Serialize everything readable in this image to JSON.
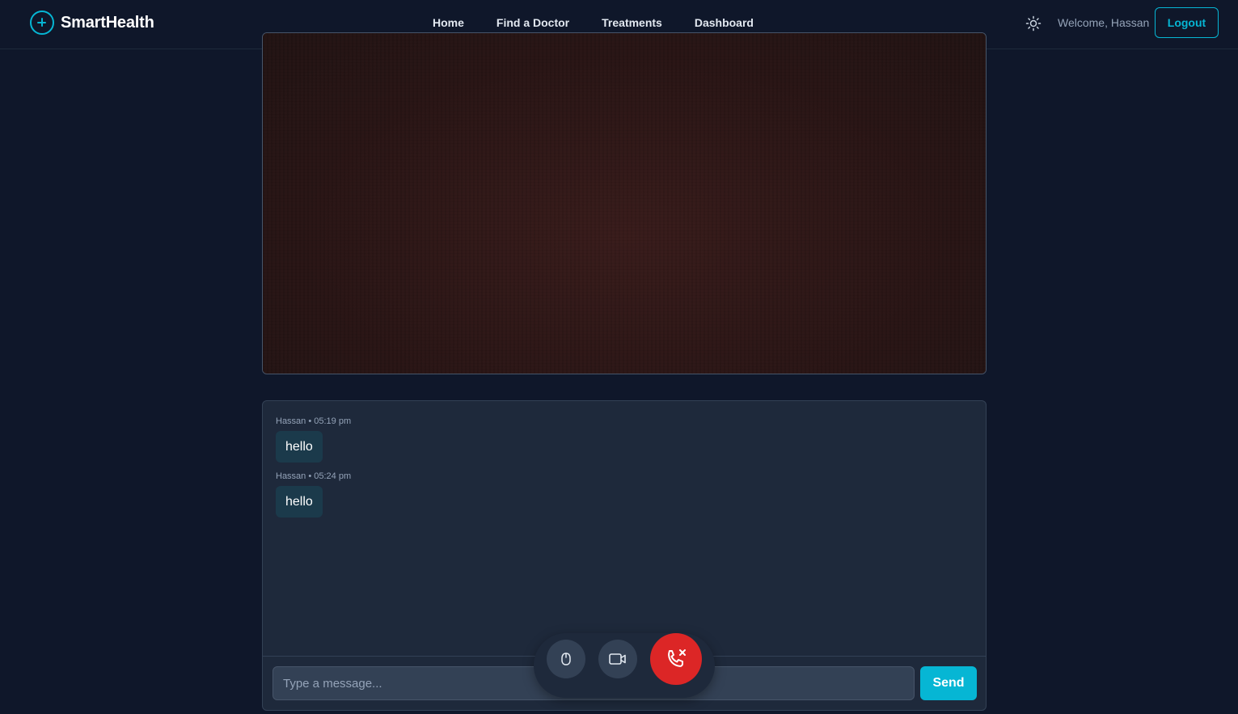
{
  "brand": {
    "name": "SmartHealth",
    "icon": "plus-circle-icon",
    "color": "#06b6d4"
  },
  "nav": {
    "links": [
      {
        "label": "Home"
      },
      {
        "label": "Find a Doctor"
      },
      {
        "label": "Treatments"
      },
      {
        "label": "Dashboard"
      }
    ],
    "theme_icon": "sun-icon",
    "welcome": "Welcome, Hassan",
    "logout_label": "Logout"
  },
  "video": {
    "state": "live-feed"
  },
  "chat": {
    "messages": [
      {
        "meta": "Hassan • 05:19 pm",
        "text": "hello"
      },
      {
        "meta": "Hassan • 05:24 pm",
        "text": "hello"
      }
    ],
    "input_placeholder": "Type a message...",
    "input_value": "",
    "send_label": "Send"
  },
  "controls": {
    "mic_icon": "microphone-icon",
    "camera_icon": "video-camera-icon",
    "end_call_icon": "phone-off-icon",
    "end_call_color": "#dc2626"
  },
  "colors": {
    "background": "#0f172a",
    "panel": "#1e293b",
    "accent": "#06b6d4"
  }
}
